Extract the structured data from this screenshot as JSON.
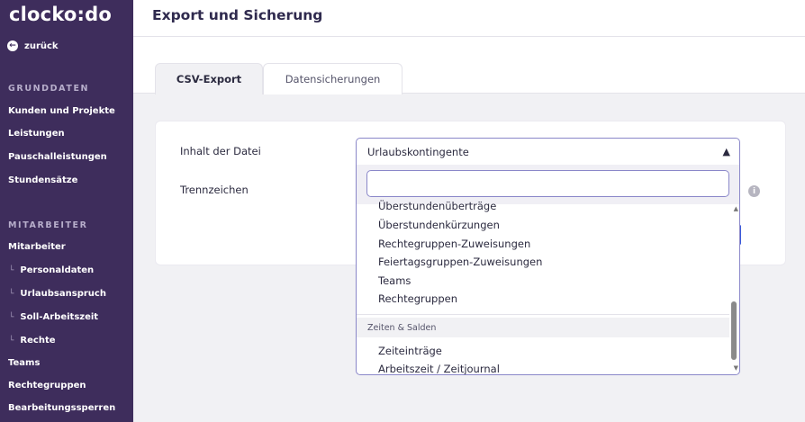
{
  "sidebar": {
    "logo": "clocko:do",
    "back_label": "zurück",
    "sections": [
      {
        "heading": "GRUNDDATEN"
      },
      {
        "heading": "MITARBEITER"
      }
    ],
    "items": [
      {
        "label": "Kunden und Projekte"
      },
      {
        "label": "Leistungen"
      },
      {
        "label": "Pauschalleistungen"
      },
      {
        "label": "Stundensätze"
      },
      {
        "label": "Mitarbeiter"
      },
      {
        "label": "Personaldaten"
      },
      {
        "label": "Urlaubsanspruch"
      },
      {
        "label": "Soll-Arbeitszeit"
      },
      {
        "label": "Rechte"
      },
      {
        "label": "Teams"
      },
      {
        "label": "Rechtegruppen"
      },
      {
        "label": "Bearbeitungssperren"
      }
    ],
    "tree_glyph": "└"
  },
  "header": {
    "title": "Export und Sicherung"
  },
  "tabs": [
    {
      "label": "CSV-Export",
      "active": true
    },
    {
      "label": "Datensicherungen",
      "active": false
    }
  ],
  "form": {
    "content_label": "Inhalt der Datei",
    "separator_label": "Trennzeichen",
    "selected_value": "Urlaubskontingente",
    "search_value": "",
    "options": [
      {
        "label": "Überstundenüberträge"
      },
      {
        "label": "Überstundenkürzungen"
      },
      {
        "label": "Rechtegruppen-Zuweisungen"
      },
      {
        "label": "Feiertagsgruppen-Zuweisungen"
      },
      {
        "label": "Teams"
      },
      {
        "label": "Rechtegruppen"
      }
    ],
    "group_heading": "Zeiten & Salden",
    "group_options": [
      {
        "label": "Zeiteinträge"
      },
      {
        "label": "Arbeitszeit / Zeitjournal"
      }
    ]
  },
  "colors": {
    "sidebar_bg": "#3e2d5c",
    "accent": "#8a87c9",
    "title": "#2f2a4e"
  }
}
